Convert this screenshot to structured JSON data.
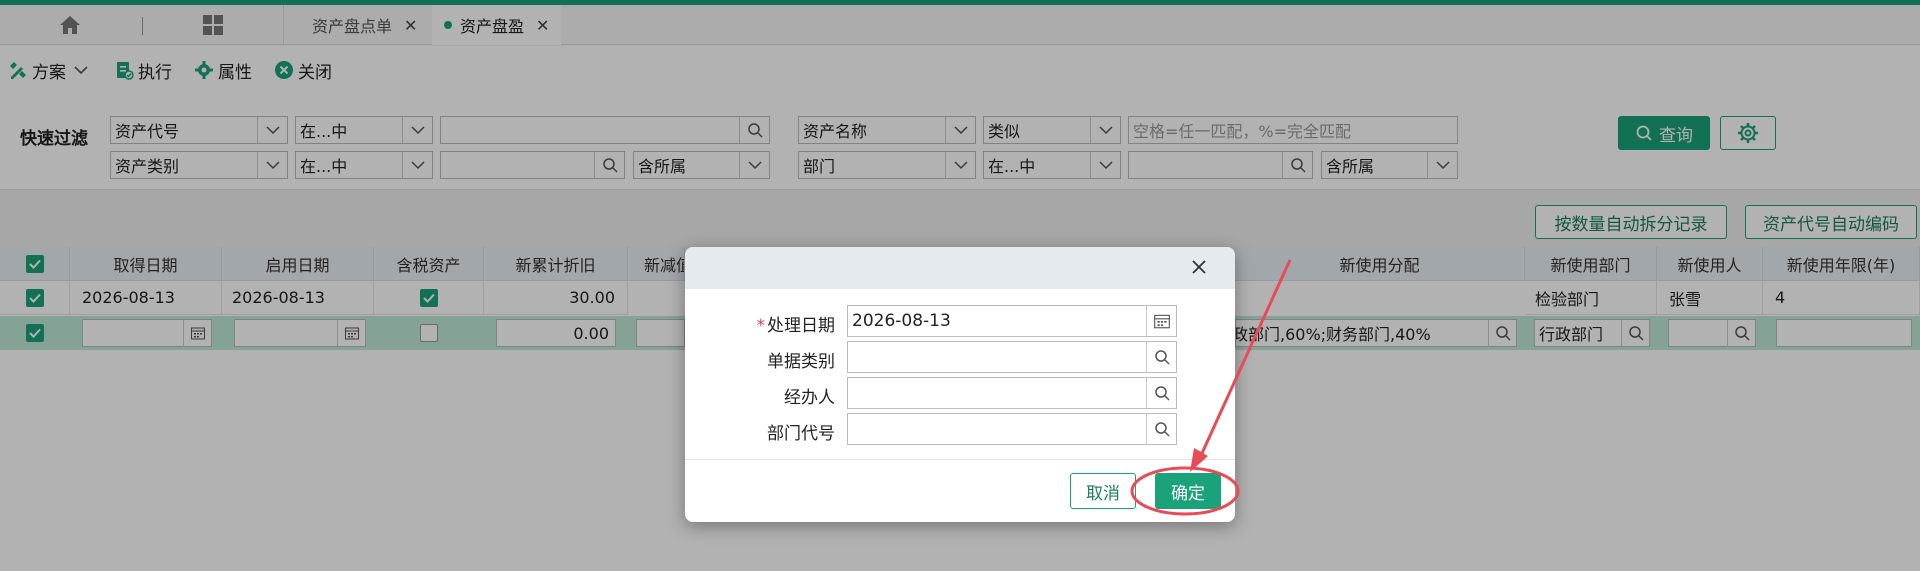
{
  "tabs": {
    "items": [
      {
        "label": "资产盘点单",
        "close": "✕"
      },
      {
        "label": "资产盘盈",
        "close": "✕"
      }
    ]
  },
  "toolbar": {
    "plan_label": "方案",
    "execute_label": "执行",
    "properties_label": "属性",
    "close_label": "关闭"
  },
  "filter": {
    "label": "快速过滤",
    "row1": {
      "field1": "资产代号",
      "op1": "在...中",
      "value1": "",
      "field2": "资产名称",
      "op2": "类似",
      "placeholder2": "空格=任一匹配，%=完全匹配"
    },
    "row2": {
      "field1": "资产类别",
      "op1": "在...中",
      "value1": "",
      "scope1": "含所属",
      "field2": "部门",
      "op2": "在...中",
      "value2": "",
      "scope2": "含所属"
    },
    "query_label": "查询"
  },
  "actions": {
    "split_label": "按数量自动拆分记录",
    "autocode_label": "资产代号自动编码"
  },
  "grid": {
    "headers": [
      "取得日期",
      "启用日期",
      "含税资产",
      "新累计折旧",
      "新减值",
      "新使用分配",
      "新使用部门",
      "新使用人",
      "新使用年限(年)"
    ],
    "rows": [
      {
        "acquire_date": "2026-08-13",
        "start_date": "2026-08-13",
        "tax_included": true,
        "depreciation": "30.00",
        "dept": "检验部门",
        "user": "张雪",
        "years": "4"
      },
      {
        "acquire_date": "",
        "start_date": "",
        "tax_included": false,
        "depreciation": "0.00",
        "allocation": "政部门,60%;财务部门,40%",
        "dept": "行政部门",
        "user": "",
        "years": ""
      }
    ]
  },
  "dialog": {
    "fields": [
      {
        "label": "处理日期",
        "required": true,
        "value": "2026-08-13"
      },
      {
        "label": "单据类别",
        "required": false,
        "value": ""
      },
      {
        "label": "经办人",
        "required": false,
        "value": ""
      },
      {
        "label": "部门代号",
        "required": false,
        "value": ""
      }
    ],
    "cancel_label": "取消",
    "ok_label": "确定"
  },
  "colors": {
    "accent": "#1aa37a",
    "annotation": "#e84b55"
  }
}
